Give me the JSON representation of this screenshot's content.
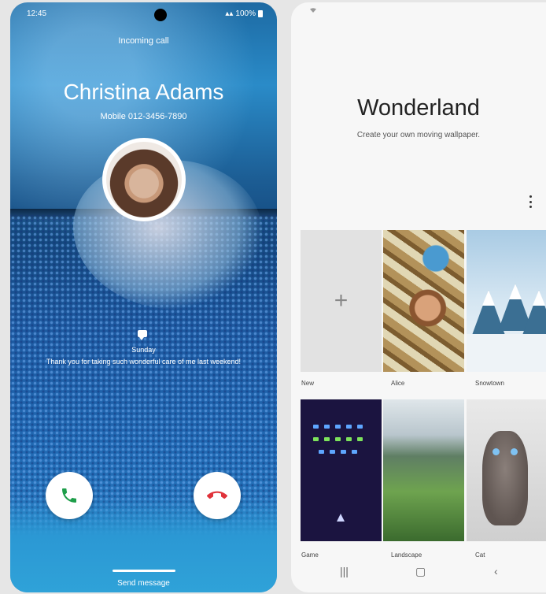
{
  "call_screen": {
    "status_time": "12:45",
    "status_battery": "100%",
    "call_state": "Incoming call",
    "caller_name": "Christina Adams",
    "caller_number": "Mobile 012-3456-7890",
    "message_day": "Sunday",
    "message_text": "Thank you for taking such wonderful care of me last weekend!",
    "send_message_label": "Send message",
    "accept_color": "#1e9e4a",
    "decline_color": "#e0323a"
  },
  "wonderland": {
    "title": "Wonderland",
    "subtitle": "Create your own moving wallpaper.",
    "tiles": [
      {
        "label": "New"
      },
      {
        "label": "Alice"
      },
      {
        "label": "Snowtown"
      },
      {
        "label": "Game"
      },
      {
        "label": "Landscape"
      },
      {
        "label": "Cat"
      }
    ],
    "nav": {
      "recents_icon": "recents-icon",
      "home_icon": "home-icon",
      "back_icon": "back-icon"
    }
  }
}
